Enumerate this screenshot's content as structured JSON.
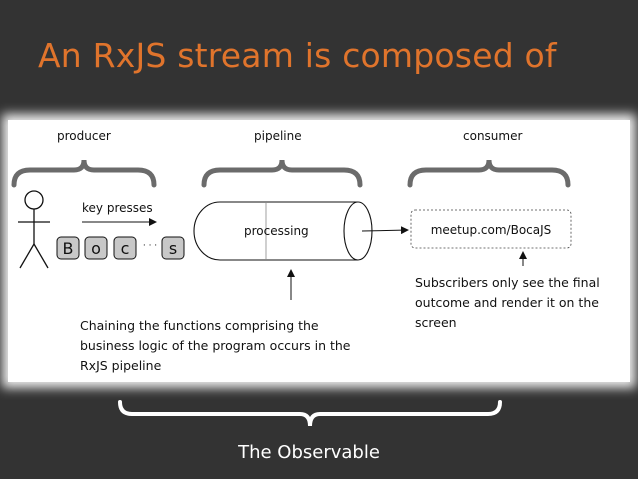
{
  "slide": {
    "title": "An RxJS stream is composed of"
  },
  "diagram": {
    "producer_label": "producer",
    "pipeline_label": "pipeline",
    "consumer_label": "consumer",
    "key_presses_label": "key presses",
    "keys": [
      "B",
      "o",
      "c",
      "s"
    ],
    "keys_ellipsis": "· · ·",
    "processing_label": "processing",
    "consumer_box_text": "meetup.com/BocaJS",
    "consumer_note": [
      "Subscribers only see the final",
      "outcome and render it on the",
      "screen"
    ],
    "pipeline_note": [
      "Chaining the functions comprising the",
      "business logic of the program occurs in the",
      "RxJS pipeline"
    ],
    "observable_label": "The Observable"
  },
  "colors": {
    "background": "#333333",
    "title": "#e0742c",
    "panel": "#ffffff",
    "brace": "#6b6b6b",
    "bottom_text": "#ffffff",
    "key_fill": "#c8c8c8"
  }
}
